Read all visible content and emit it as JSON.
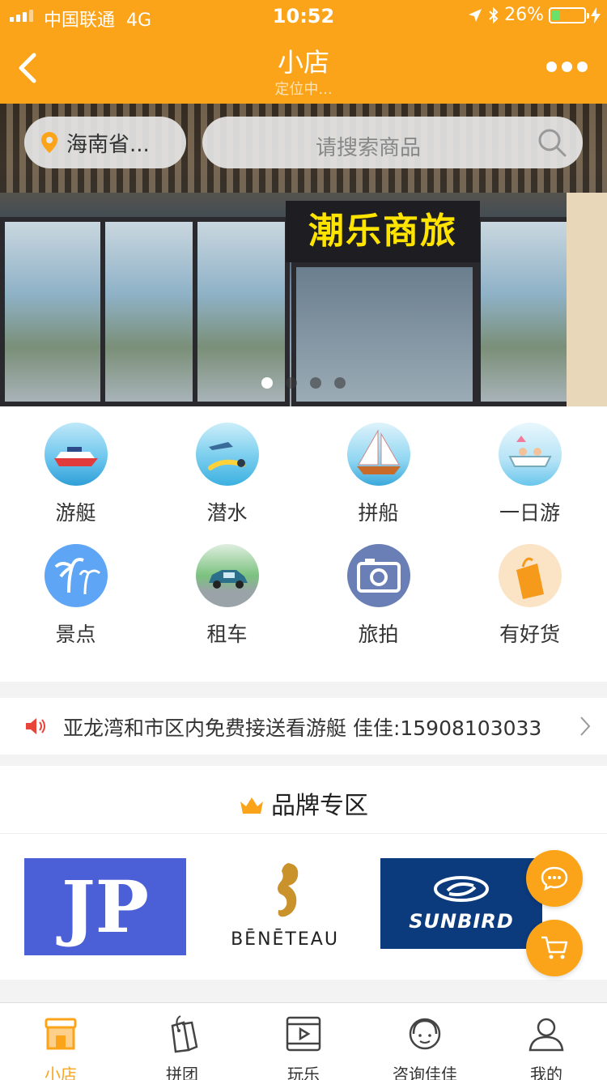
{
  "status": {
    "carrier": "中国联通",
    "network": "4G",
    "time": "10:52",
    "battery": "26%",
    "battery_level": 0.26
  },
  "nav": {
    "title": "小店",
    "subtitle": "定位中..."
  },
  "banner": {
    "sign_text": "潮乐商旅",
    "active_slide": 0,
    "slides": 4
  },
  "location": {
    "label": "海南省..."
  },
  "search": {
    "placeholder": "请搜索商品"
  },
  "categories": [
    {
      "label": "游艇",
      "icon": "yacht-icon"
    },
    {
      "label": "潜水",
      "icon": "diving-icon"
    },
    {
      "label": "拼船",
      "icon": "sailboat-icon"
    },
    {
      "label": "一日游",
      "icon": "day-tour-icon"
    },
    {
      "label": "景点",
      "icon": "palm-tree-icon"
    },
    {
      "label": "租车",
      "icon": "car-icon"
    },
    {
      "label": "旅拍",
      "icon": "camera-icon"
    },
    {
      "label": "有好货",
      "icon": "shopping-bag-icon"
    }
  ],
  "notice": {
    "text": "亚龙湾和市区内免费接送看游艇 佳佳:15908103033"
  },
  "brand_section": {
    "title": "品牌专区",
    "brands": [
      {
        "name": "JP"
      },
      {
        "name": "BĒNĒTEAU"
      },
      {
        "name": "SUNBIRD"
      }
    ]
  },
  "tabs": [
    {
      "label": "小店",
      "icon": "shop-icon",
      "active": true
    },
    {
      "label": "拼团",
      "icon": "tag-icon",
      "active": false
    },
    {
      "label": "玩乐",
      "icon": "video-icon",
      "active": false
    },
    {
      "label": "咨询佳佳",
      "icon": "support-agent-icon",
      "active": false
    },
    {
      "label": "我的",
      "icon": "user-icon",
      "active": false
    }
  ],
  "colors": {
    "accent": "#fba419",
    "active_tab": "#fba419"
  }
}
